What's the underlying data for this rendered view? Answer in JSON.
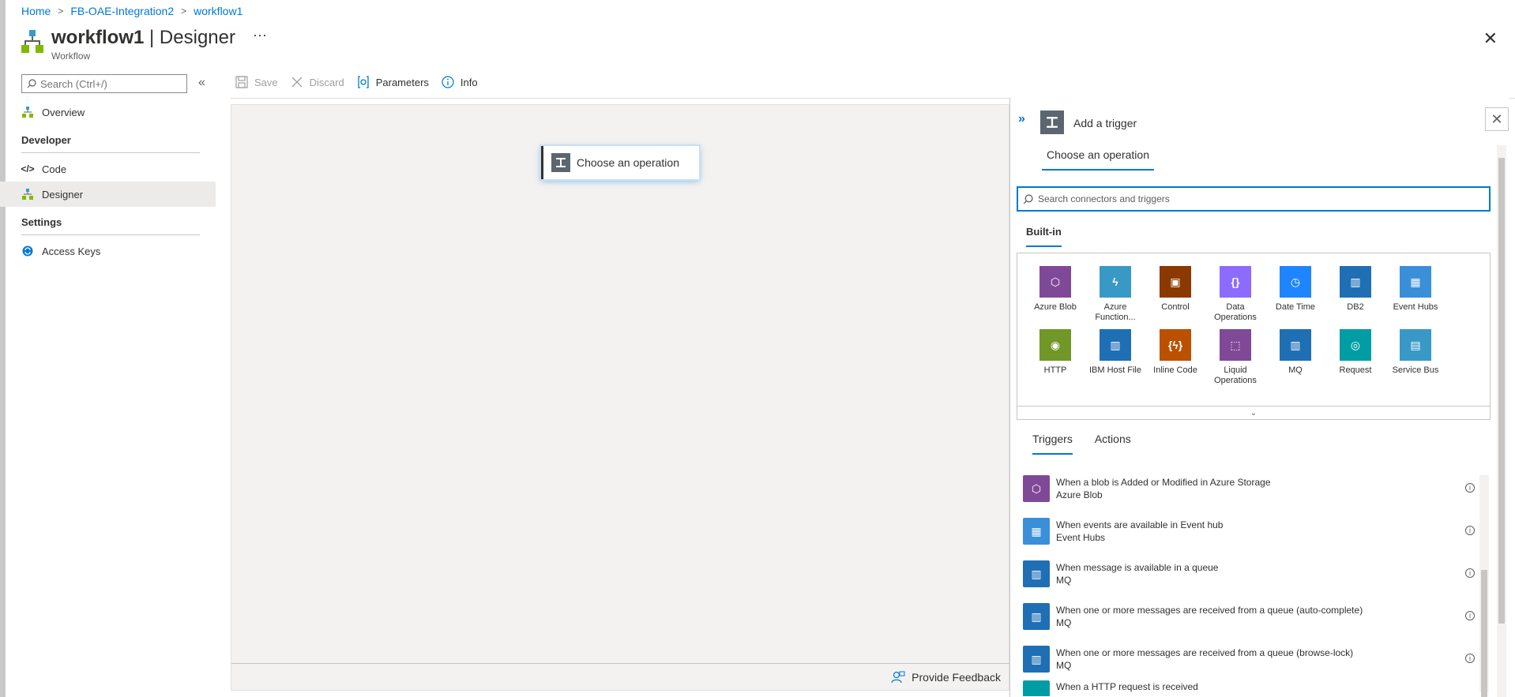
{
  "breadcrumb": [
    "Home",
    "FB-OAE-Integration2",
    "workflow1"
  ],
  "header": {
    "title_bold": "workflow1",
    "title_rest": " | Designer",
    "subtitle": "Workflow",
    "more": "···",
    "close": "✕"
  },
  "sidebar": {
    "search_placeholder": "Search (Ctrl+/)",
    "collapse": "«",
    "items": [
      {
        "label": "Overview",
        "icon": "workflow-icon"
      },
      {
        "section": "Developer"
      },
      {
        "label": "Code",
        "icon": "code-icon"
      },
      {
        "label": "Designer",
        "icon": "designer-icon",
        "active": true
      },
      {
        "section": "Settings"
      },
      {
        "label": "Access Keys",
        "icon": "key-sync-icon"
      }
    ]
  },
  "toolbar": {
    "save": "Save",
    "discard": "Discard",
    "parameters": "Parameters",
    "info": "Info"
  },
  "canvas": {
    "card_label": "Choose an operation",
    "feedback": "Provide Feedback"
  },
  "panel": {
    "title": "Add a trigger",
    "tab": "Choose an operation",
    "search_placeholder": "Search connectors and triggers",
    "builtin_tab": "Built-in",
    "connectors": [
      {
        "label": "Azure Blob",
        "color": "#804998",
        "glyph": "⬡"
      },
      {
        "label": "Azure Function...",
        "color": "#3999c6",
        "glyph": "ϟ"
      },
      {
        "label": "Control",
        "color": "#8c3900",
        "glyph": "▣"
      },
      {
        "label": "Data Operations",
        "color": "#8c6cff",
        "glyph": "{}"
      },
      {
        "label": "Date Time",
        "color": "#1f85ff",
        "glyph": "◷"
      },
      {
        "label": "DB2",
        "color": "#1f6fb5",
        "glyph": "▥"
      },
      {
        "label": "Event Hubs",
        "color": "#3a8fd9",
        "glyph": "▦"
      },
      {
        "label": "HTTP",
        "color": "#709727",
        "glyph": "◉"
      },
      {
        "label": "IBM Host File",
        "color": "#1f6fb5",
        "glyph": "▥"
      },
      {
        "label": "Inline Code",
        "color": "#ba5000",
        "glyph": "{ϟ}"
      },
      {
        "label": "Liquid Operations",
        "color": "#804998",
        "glyph": "⬚"
      },
      {
        "label": "MQ",
        "color": "#1f6fb5",
        "glyph": "▥"
      },
      {
        "label": "Request",
        "color": "#009da5",
        "glyph": "◎"
      },
      {
        "label": "Service Bus",
        "color": "#3999c6",
        "glyph": "▤"
      }
    ],
    "expand_chevron": "⌄",
    "tabs": [
      "Triggers",
      "Actions"
    ],
    "triggers": [
      {
        "title": "When a blob is Added or Modified in Azure Storage",
        "sub": "Azure Blob",
        "color": "#804998",
        "glyph": "⬡"
      },
      {
        "title": "When events are available in Event hub",
        "sub": "Event Hubs",
        "color": "#3a8fd9",
        "glyph": "▦"
      },
      {
        "title": "When message is available in a queue",
        "sub": "MQ",
        "color": "#1f6fb5",
        "glyph": "▥"
      },
      {
        "title": "When one or more messages are received from a queue (auto-complete)",
        "sub": "MQ",
        "color": "#1f6fb5",
        "glyph": "▥"
      },
      {
        "title": "When one or more messages are received from a queue (browse-lock)",
        "sub": "MQ",
        "color": "#1f6fb5",
        "glyph": "▥"
      },
      {
        "title": "When a HTTP request is received",
        "sub": "",
        "color": "#009da5",
        "glyph": ""
      }
    ]
  }
}
